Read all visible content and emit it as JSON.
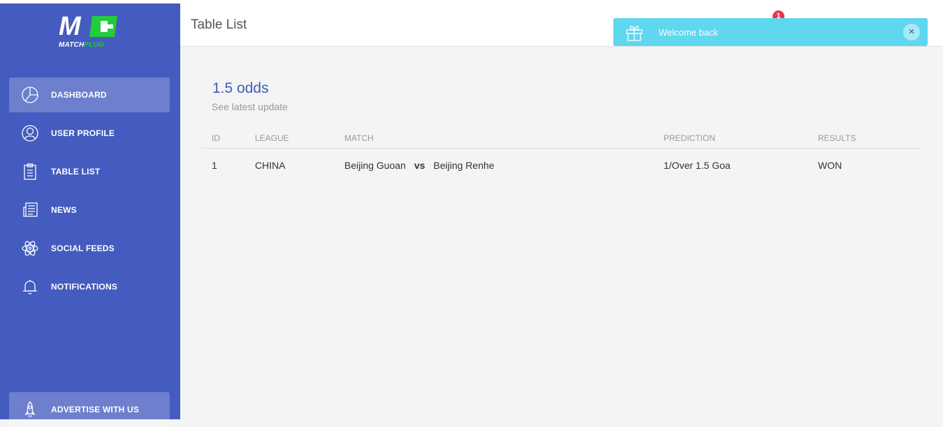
{
  "brand": {
    "logo_mark": "M",
    "wordmark_white": "MATCH",
    "wordmark_green": "PLUG"
  },
  "sidebar": {
    "items": [
      {
        "label": "DASHBOARD",
        "icon": "pie-chart-icon",
        "active": true
      },
      {
        "label": "USER PROFILE",
        "icon": "user-icon"
      },
      {
        "label": "TABLE LIST",
        "icon": "clipboard-icon"
      },
      {
        "label": "NEWS",
        "icon": "newspaper-icon"
      },
      {
        "label": "SOCIAL FEEDS",
        "icon": "atom-icon"
      },
      {
        "label": "NOTIFICATIONS",
        "icon": "bell-icon"
      }
    ],
    "advertise": {
      "label": "ADVERTISE WITH US",
      "icon": "rocket-icon"
    }
  },
  "header": {
    "title": "Table List",
    "notification_count": "1"
  },
  "toast": {
    "message": "Welcome back",
    "icon": "gift-icon",
    "close": "×"
  },
  "card": {
    "title": "1.5 odds",
    "subtitle": "See latest update",
    "columns": [
      "ID",
      "LEAGUE",
      "MATCH",
      "PREDICTION",
      "RESULTS"
    ],
    "rows": [
      {
        "id": "1",
        "league": "CHINA",
        "home": "Beijing Guoan",
        "vs": "vs",
        "away": "Beijing Renhe",
        "prediction": "1/Over 1.5 Goa",
        "result": "WON"
      }
    ]
  },
  "colors": {
    "sidebar": "#445bbf",
    "accent": "#3f5bbf",
    "toast": "#5fd7ef",
    "badge": "#f0334d",
    "logo_green": "#22cc3a"
  }
}
